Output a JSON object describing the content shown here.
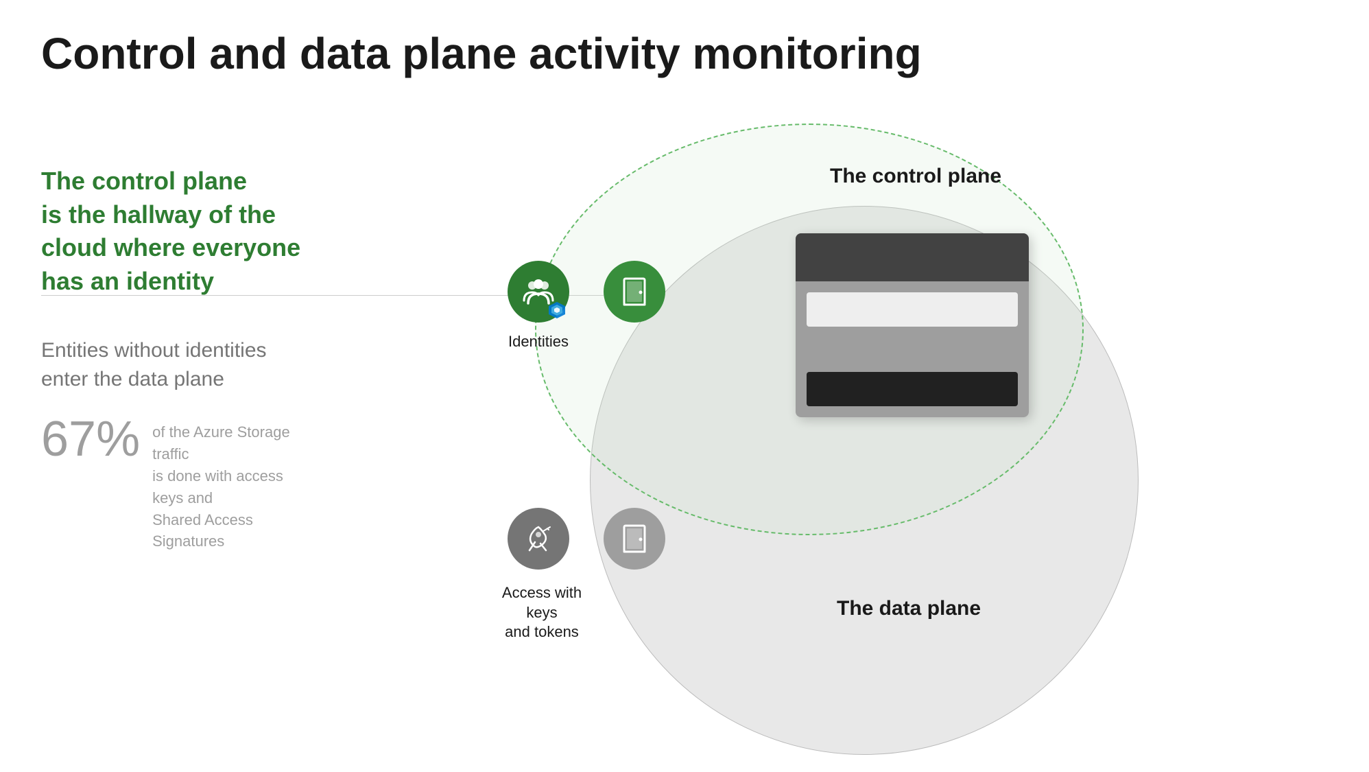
{
  "page": {
    "title": "Control and data plane activity monitoring",
    "green_heading_line1": "The control plane",
    "green_heading_line2": "is the hallway of the",
    "green_heading_line3": "cloud where everyone",
    "green_heading_line4": "has an identity",
    "gray_subheading": "Entities without identities\nenter the data plane",
    "stat_percent": "67%",
    "stat_desc_line1": "of the Azure Storage traffic",
    "stat_desc_line2": "is done with access keys and",
    "stat_desc_line3": "Shared Access Signatures",
    "label_control_plane": "The control plane",
    "label_data_plane": "The data plane",
    "label_identities": "Identities",
    "label_keys": "Access with keys\nand tokens"
  },
  "colors": {
    "green_dark": "#2e7d32",
    "green_mid": "#388e3c",
    "green_light_border": "#66bb6a",
    "gray_text": "#757575",
    "gray_light": "#9e9e9e",
    "title_black": "#1a1a1a",
    "accent_green_text": "#2e7d32"
  }
}
